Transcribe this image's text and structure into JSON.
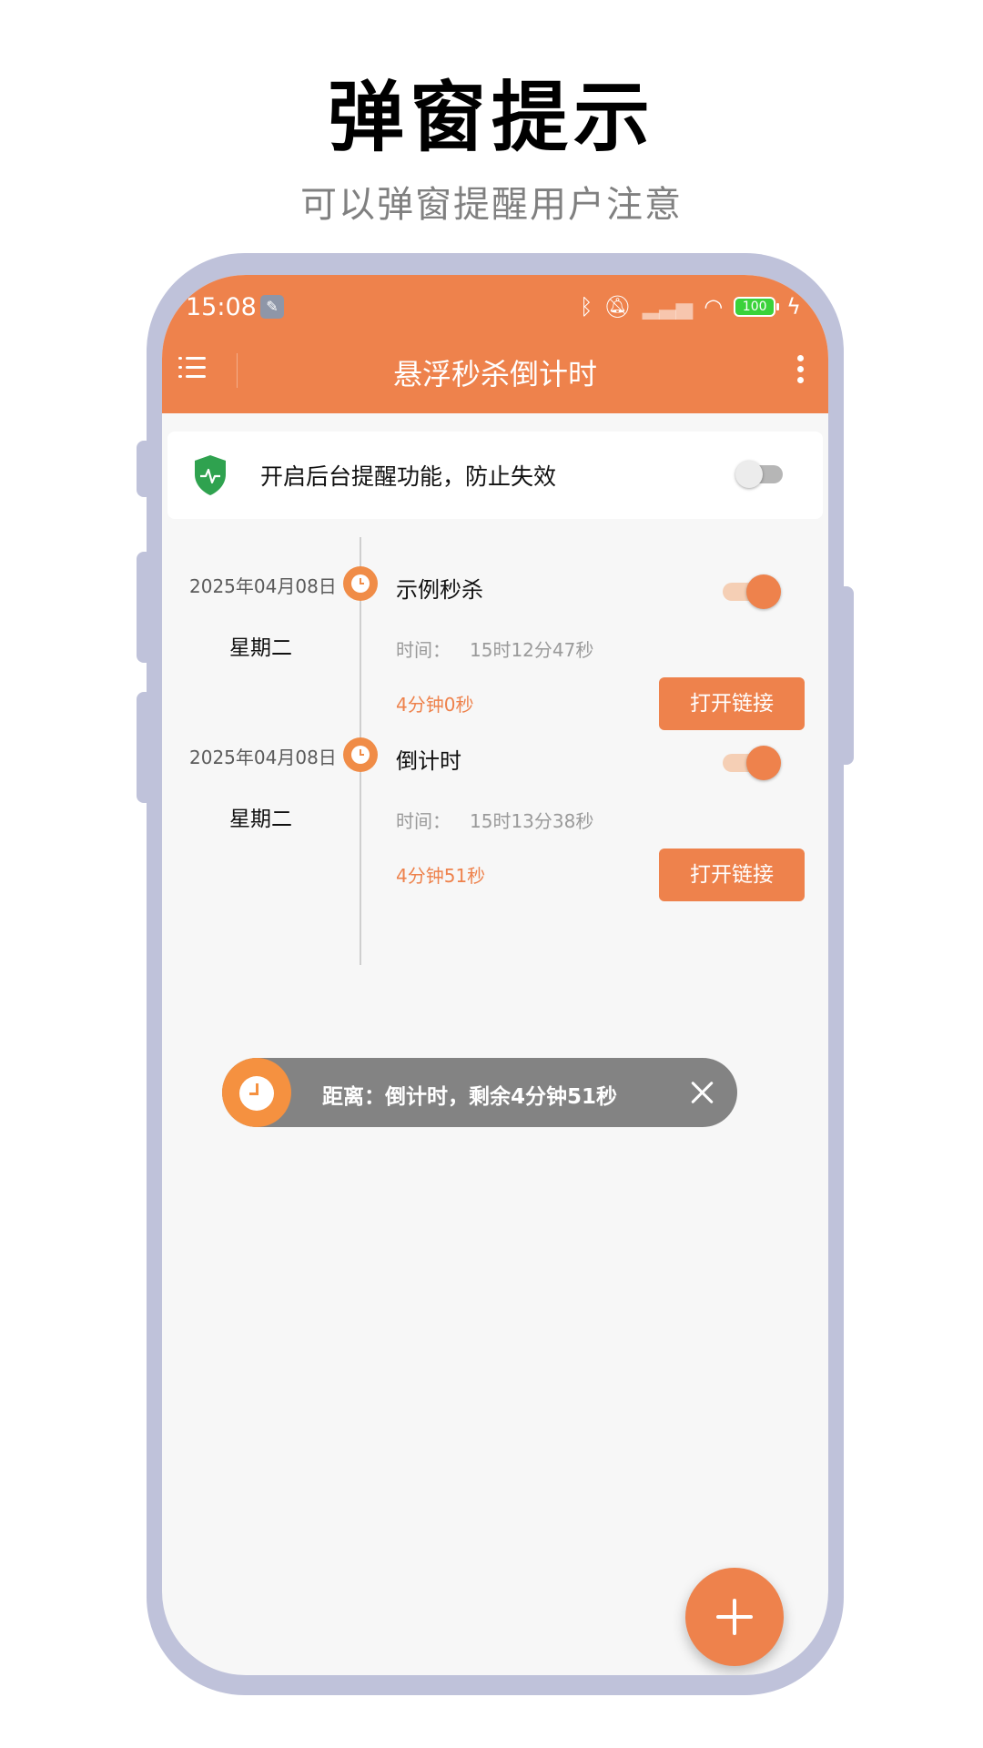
{
  "promo": {
    "title": "弹窗提示",
    "subtitle": "可以弹窗提醒用户注意"
  },
  "status_bar": {
    "time": "15:08",
    "battery": "100",
    "icons": [
      "wrench-icon",
      "bluetooth-icon",
      "mute-icon",
      "signal-icon",
      "wifi-icon",
      "battery-icon",
      "charging-icon"
    ]
  },
  "app_bar": {
    "title": "悬浮秒杀倒计时",
    "menu_icon": "menu-icon",
    "more_icon": "more-vertical-icon"
  },
  "reminder": {
    "text": "开启后台提醒功能，防止失效",
    "enabled": false,
    "icon": "shield-icon"
  },
  "events": [
    {
      "date": "2025年04月08日",
      "weekday": "星期二",
      "name": "示例秒杀",
      "time_label": "时间：",
      "time_value": "15时12分47秒",
      "remaining": "4分钟0秒",
      "button": "打开链接",
      "enabled": true
    },
    {
      "date": "2025年04月08日",
      "weekday": "星期二",
      "name": "倒计时",
      "time_label": "时间：",
      "time_value": "15时13分38秒",
      "remaining": "4分钟51秒",
      "button": "打开链接",
      "enabled": true
    }
  ],
  "floating_popup": {
    "text": "距离：倒计时，剩余4分钟51秒",
    "icon": "alarm-clock-icon",
    "close_icon": "close-icon"
  },
  "fab": {
    "icon": "plus-icon"
  },
  "colors": {
    "accent": "#ee824c",
    "frame": "#bfc2da",
    "popup_bg": "#838383",
    "shield": "#2fa24f"
  }
}
